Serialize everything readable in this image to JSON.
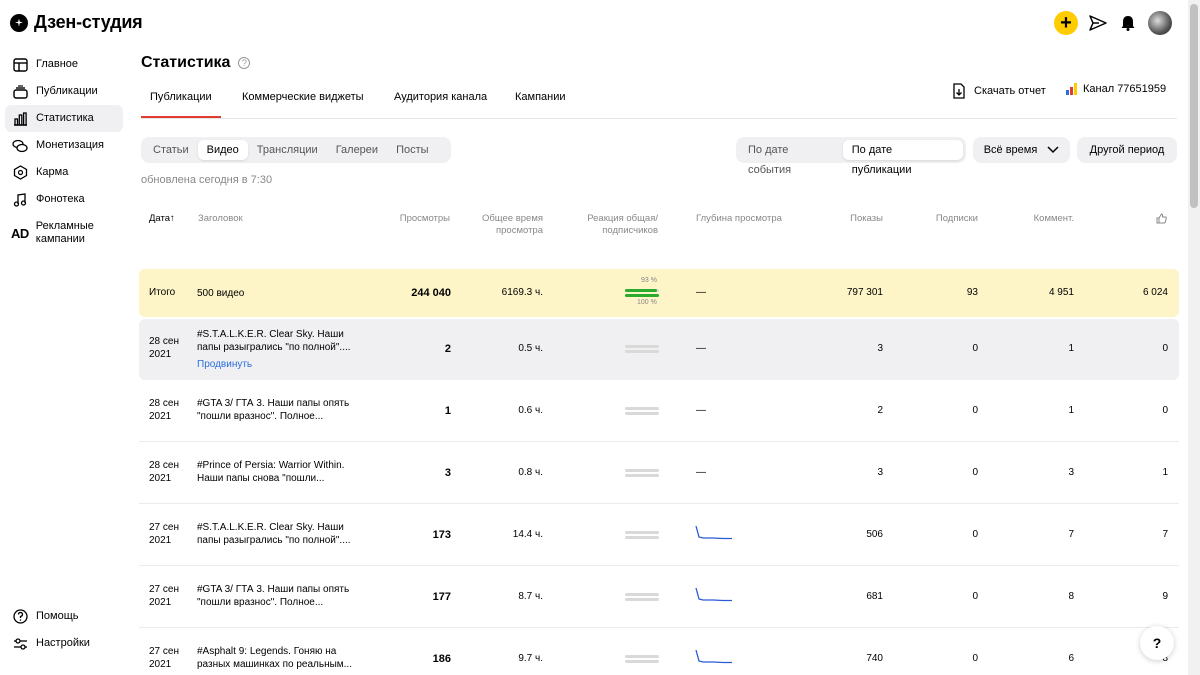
{
  "app": {
    "title": "Дзен-студия"
  },
  "sidebar": {
    "items": [
      {
        "label": "Главное",
        "icon": "dashboard-icon"
      },
      {
        "label": "Публикации",
        "icon": "publications-icon"
      },
      {
        "label": "Статистика",
        "icon": "chart-icon",
        "active": true
      },
      {
        "label": "Монетизация",
        "icon": "coins-icon"
      },
      {
        "label": "Карма",
        "icon": "karma-icon"
      },
      {
        "label": "Фонотека",
        "icon": "music-icon"
      },
      {
        "label": "Рекламные кампании",
        "icon": "ad-icon",
        "icon_text": "AD"
      }
    ],
    "bottom": [
      {
        "label": "Помощь",
        "icon": "help-icon"
      },
      {
        "label": "Настройки",
        "icon": "settings-icon"
      }
    ]
  },
  "header": {
    "title": "Статистика",
    "help_glyph": "?",
    "tabs": [
      "Публикации",
      "Коммерческие виджеты",
      "Аудитория канала",
      "Кампании"
    ],
    "download_label": "Скачать отчет",
    "channel_label": "Канал 77651959",
    "accent": "#e03c31",
    "plus_color": "#ffcc00"
  },
  "filters": {
    "types": [
      "Статьи",
      "Видео",
      "Трансляции",
      "Галереи",
      "Посты"
    ],
    "active_type": "Видео",
    "date_modes": [
      "По дате события",
      "По дате публикации"
    ],
    "active_date_mode": "По дате публикации",
    "period": "Всё время",
    "other_period": "Другой период"
  },
  "updated_text": "обновлена сегодня в 7:30",
  "table": {
    "columns": {
      "date": "Дата",
      "sort_glyph": "↑",
      "title": "Заголовок",
      "views": "Просмотры",
      "watch_time": "Общее время просмотра",
      "reaction": "Реакция общая/ подписчиков",
      "depth": "Глубина просмотра",
      "impressions": "Показы",
      "subs": "Подписки",
      "comments": "Коммент.",
      "likes_icon": "thumbs-up-icon"
    },
    "total": {
      "label": "Итого",
      "title": "500 видео",
      "views": "244 040",
      "watch_time": "6169.3 ч.",
      "reaction_total": "93 %",
      "reaction_subs": "100 %",
      "reaction_total_frac": 0.93,
      "reaction_subs_frac": 1.0,
      "depth": "—",
      "impressions": "797 301",
      "subs": "93",
      "comments": "4 951",
      "likes": "6 024"
    },
    "rows": [
      {
        "date1": "28 сен",
        "date2": "2021",
        "title1": "#S.T.A.L.K.E.R. Clear Sky. Наши",
        "title2": "папы разыгрались \"по полной\"....",
        "promote": "Продвинуть",
        "views": "2",
        "watch_time": "0.5 ч.",
        "depth": "—",
        "impressions": "3",
        "subs": "0",
        "comments": "1",
        "likes": "0"
      },
      {
        "date1": "28 сен",
        "date2": "2021",
        "title1": "#GTA 3/ ГТА 3. Наши папы опять",
        "title2": "\"пошли вразнос\". Полное...",
        "views": "1",
        "watch_time": "0.6 ч.",
        "depth": "—",
        "impressions": "2",
        "subs": "0",
        "comments": "1",
        "likes": "0"
      },
      {
        "date1": "28 сен",
        "date2": "2021",
        "title1": "#Prince of Persia: Warrior Within.",
        "title2": "Наши папы снова \"пошли...",
        "views": "3",
        "watch_time": "0.8 ч.",
        "depth": "—",
        "impressions": "3",
        "subs": "0",
        "comments": "3",
        "likes": "1"
      },
      {
        "date1": "27 сен",
        "date2": "2021",
        "title1": "#S.T.A.L.K.E.R. Clear Sky. Наши",
        "title2": "папы разыгрались \"по полной\"....",
        "views": "173",
        "watch_time": "14.4 ч.",
        "spark": true,
        "impressions": "506",
        "subs": "0",
        "comments": "7",
        "likes": "7"
      },
      {
        "date1": "27 сен",
        "date2": "2021",
        "title1": "#GTA 3/ ГТА 3. Наши папы опять",
        "title2": "\"пошли вразнос\". Полное...",
        "views": "177",
        "watch_time": "8.7 ч.",
        "spark": true,
        "impressions": "681",
        "subs": "0",
        "comments": "8",
        "likes": "9"
      },
      {
        "date1": "27 сен",
        "date2": "2021",
        "title1": "#Asphalt 9: Legends. Гоняю на",
        "title2": "разных машинках по реальным...",
        "views": "186",
        "watch_time": "9.7 ч.",
        "spark": true,
        "impressions": "740",
        "subs": "0",
        "comments": "6",
        "likes": "8"
      }
    ]
  },
  "help_fab": "?"
}
